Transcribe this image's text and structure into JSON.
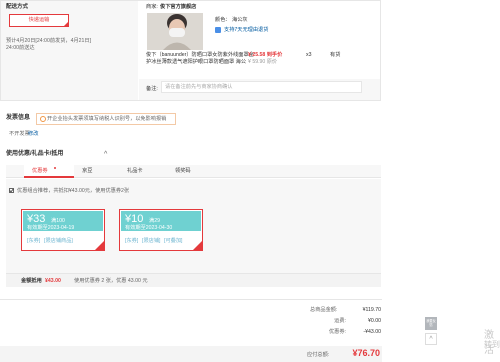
{
  "delivery": {
    "title": "配送方式",
    "option": "快递运输",
    "eta": "预计4月20日[24:00前发货，4月21日]",
    "note": "24:00前送达"
  },
  "seller": {
    "label": "商家:",
    "name": "俊下官方旗舰店"
  },
  "product": {
    "color_label": "颜色：",
    "color_value": "海公灰",
    "service": "支持7天无理由退货",
    "name_line1": "俊下（banuunder）防晒口罩女防紫外线面罩全",
    "name_line2": "护冰丝薄款透气遮阳护眼口罩防晒面罩 海公",
    "price": "¥ 25.58 到手价",
    "orig_price": "¥ 59.90 原价",
    "qty": "x3",
    "stock": "有货",
    "remark_label": "备注:",
    "remark_placeholder": "请在备注前先与商家协商确认"
  },
  "invoice": {
    "title": "发票信息",
    "tip": "开企业抬头发票须填写纳税人识别号，以免影响报销",
    "current": "不开发票",
    "edit": "修改"
  },
  "coupon": {
    "section_title": "使用优惠/礼品卡/抵用",
    "toggle": "^",
    "tabs": [
      "优惠券",
      "京豆",
      "礼品卡",
      "领奖码"
    ],
    "combo_text": "优惠组合推荐，共抵扣¥43.00元，使用优惠券2张",
    "cards": [
      {
        "amount": "¥33",
        "cond": "满100",
        "expiry": "有效期至2023-04-19",
        "tags": [
          "[东券]",
          "[限店铺商品]",
          ""
        ]
      },
      {
        "amount": "¥10",
        "cond": "满29",
        "expiry": "有效期至2023-04-30",
        "tags": [
          "[东券]",
          "[限店铺]",
          "[可叠加]"
        ]
      }
    ],
    "summary_label": "金额抵用",
    "summary_amount": "¥43.00",
    "summary_detail": "使用优惠券 2 张，优惠 43.00 元"
  },
  "totals": {
    "rows": [
      {
        "label": "总商品金额:",
        "value": "¥119.70"
      },
      {
        "label": "运费:",
        "value": "¥0.00"
      },
      {
        "label": "优惠券:",
        "value": "-¥43.00"
      }
    ],
    "payable_label": "应付总额:",
    "payable_value": "¥76.70"
  },
  "side": {
    "feedback": "我要反馈",
    "up": "^",
    "watermark1": "激活",
    "watermark2": "转到"
  },
  "colors": {
    "accent": "#e4393c",
    "coupon_teal": "#6fd1d1",
    "link_blue": "#005aa0"
  }
}
